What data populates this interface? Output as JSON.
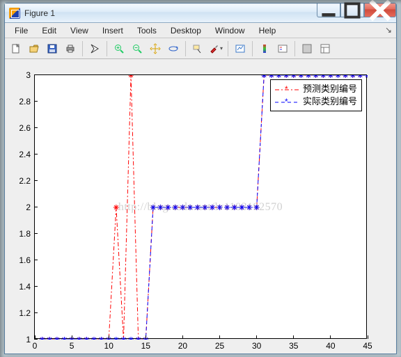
{
  "window": {
    "title": "Figure 1"
  },
  "menu": {
    "file": "File",
    "edit": "Edit",
    "view": "View",
    "insert": "Insert",
    "tools": "Tools",
    "desktop": "Desktop",
    "window": "Window",
    "help": "Help"
  },
  "legend": {
    "s1": "预测类别编号",
    "s2": "实际类别编号"
  },
  "watermark": "http://blog.csdn.net/lv1103192570",
  "chart_data": {
    "type": "line",
    "xlabel": "",
    "ylabel": "",
    "xlim": [
      0,
      45
    ],
    "ylim": [
      1,
      3
    ],
    "xticks": [
      0,
      5,
      10,
      15,
      20,
      25,
      30,
      35,
      40,
      45
    ],
    "yticks": [
      1,
      1.2,
      1.4,
      1.6,
      1.8,
      2,
      2.2,
      2.4,
      2.6,
      2.8,
      3
    ],
    "x": [
      1,
      2,
      3,
      4,
      5,
      6,
      7,
      8,
      9,
      10,
      11,
      12,
      13,
      14,
      15,
      16,
      17,
      18,
      19,
      20,
      21,
      22,
      23,
      24,
      25,
      26,
      27,
      28,
      29,
      30,
      31,
      32,
      33,
      34,
      35,
      36,
      37,
      38,
      39,
      40,
      41,
      42,
      43,
      44,
      45
    ],
    "series": [
      {
        "name": "预测类别编号",
        "color": "#ff0000",
        "marker": "*",
        "dash": "6,3,2,3",
        "values": [
          1,
          1,
          1,
          1,
          1,
          1,
          1,
          1,
          1,
          1,
          2,
          1,
          3,
          1,
          1,
          2,
          2,
          2,
          2,
          2,
          2,
          2,
          2,
          2,
          2,
          2,
          2,
          2,
          2,
          2,
          3,
          3,
          3,
          3,
          3,
          3,
          3,
          3,
          3,
          3,
          3,
          3,
          3,
          3,
          3
        ]
      },
      {
        "name": "实际类别编号",
        "color": "#0000ff",
        "marker": "*",
        "dash": "5,4",
        "values": [
          1,
          1,
          1,
          1,
          1,
          1,
          1,
          1,
          1,
          1,
          1,
          1,
          1,
          1,
          1,
          2,
          2,
          2,
          2,
          2,
          2,
          2,
          2,
          2,
          2,
          2,
          2,
          2,
          2,
          2,
          3,
          3,
          3,
          3,
          3,
          3,
          3,
          3,
          3,
          3,
          3,
          3,
          3,
          3,
          3
        ]
      }
    ]
  }
}
